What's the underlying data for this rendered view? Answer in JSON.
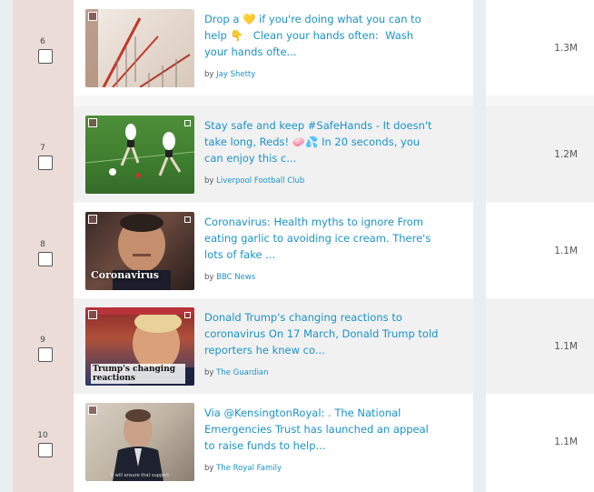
{
  "rows": [
    {
      "rank": "6",
      "text": "Drop a 💛 if you're doing what you can to help 👇 ⁣ ⁣ Clean your hands often: ⁣ Wash your hands ofte...",
      "by_label": "by",
      "author": "Jay Shetty",
      "metric": "1.3M",
      "thumb_caption": "",
      "thumb_subtitle": ""
    },
    {
      "rank": "7",
      "text": "Stay safe and keep #SafeHands - It doesn't take long, Reds! 🧼💦 In 20 seconds, you can enjoy this c...",
      "by_label": "by",
      "author": "Liverpool Football Club",
      "metric": "1.2M",
      "thumb_caption": "",
      "thumb_subtitle": ""
    },
    {
      "rank": "8",
      "text": "Coronavirus: Health myths to ignore From eating garlic to avoiding ice cream. There's lots of fake ...",
      "by_label": "by",
      "author": "BBC News",
      "metric": "1.1M",
      "thumb_caption": "Coronavirus",
      "thumb_subtitle": ""
    },
    {
      "rank": "9",
      "text": "Donald Trump's changing reactions to coronavirus On 17 March, Donald Trump told reporters he knew co...",
      "by_label": "by",
      "author": "The Guardian",
      "metric": "1.1M",
      "thumb_caption": "Trump's changing reactions",
      "thumb_subtitle": ""
    },
    {
      "rank": "10",
      "text": "Via @KensingtonRoyal: . The National Emergencies Trust has launched an appeal to raise funds to help...",
      "by_label": "by",
      "author": "The Royal Family",
      "metric": "1.1M",
      "thumb_caption": "",
      "thumb_subtitle": "It will ensure that support"
    }
  ]
}
